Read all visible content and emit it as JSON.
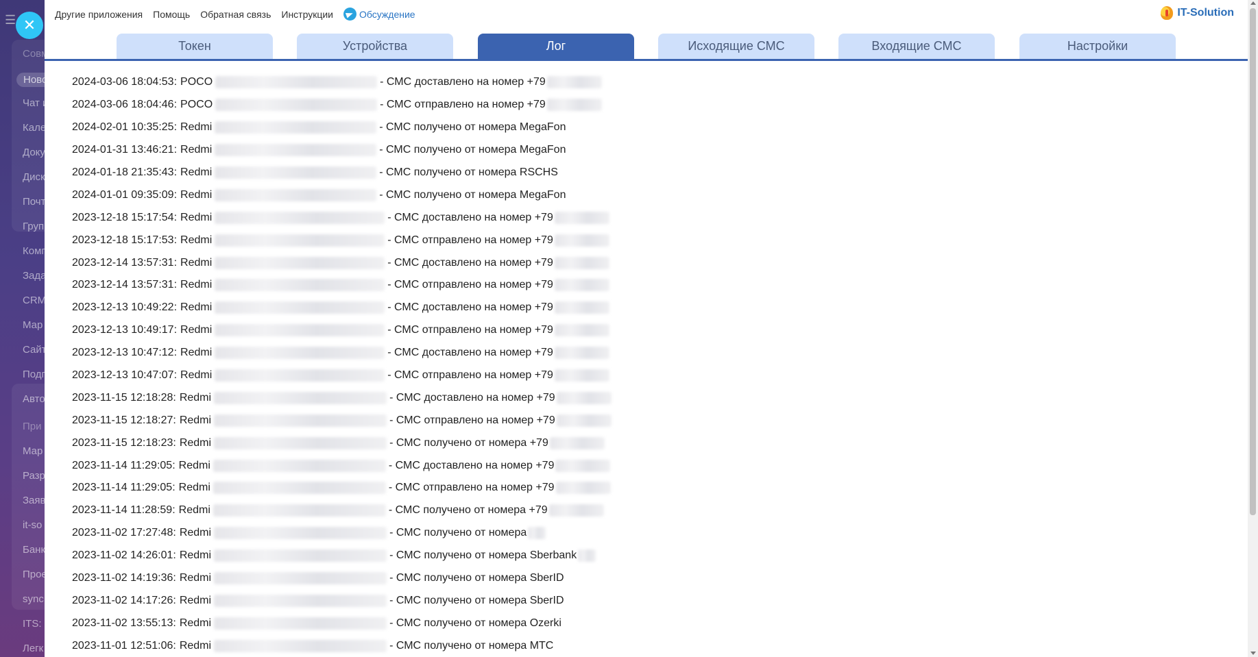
{
  "sidebar": {
    "items": [
      "Совм",
      "Ново",
      "Чат и",
      "Кале",
      "Доку",
      "Диск",
      "Почт",
      "Груп",
      "Комп",
      "Зада",
      "CRM",
      "Мар",
      "Сайт",
      "Подп",
      "Авто",
      "При",
      "Мар",
      "Разр",
      "Заяв",
      "it-so",
      "Банк",
      "Прое",
      "sync",
      "ITS: ",
      "Легк"
    ]
  },
  "topbar": {
    "links": [
      "Другие приложения",
      "Помощь",
      "Обратная связь",
      "Инструкции"
    ],
    "telegram_link": "Обсуждение",
    "brand": "IT-Solution"
  },
  "tabs": [
    {
      "label": "Токен",
      "active": false
    },
    {
      "label": "Устройства",
      "active": false
    },
    {
      "label": "Лог",
      "active": true
    },
    {
      "label": "Исходящие СМС",
      "active": false
    },
    {
      "label": "Входящие СМС",
      "active": false
    },
    {
      "label": "Настройки",
      "active": false
    }
  ],
  "log": [
    {
      "time": "2024-03-06 18:04:53:",
      "device": "POCO",
      "message": "- СМС доставлено на номер +79",
      "tail": "phone"
    },
    {
      "time": "2024-03-06 18:04:46:",
      "device": "POCO",
      "message": "- СМС отправлено на номер +79",
      "tail": "phone"
    },
    {
      "time": "2024-02-01 10:35:25:",
      "device": "Redmi",
      "message": "- СМС получено от номера MegaFon",
      "tail": ""
    },
    {
      "time": "2024-01-31 13:46:21:",
      "device": "Redmi",
      "message": "- СМС получено от номера MegaFon",
      "tail": ""
    },
    {
      "time": "2024-01-18 21:35:43:",
      "device": "Redmi",
      "message": "- СМС получено от номера RSCHS",
      "tail": ""
    },
    {
      "time": "2024-01-01 09:35:09:",
      "device": "Redmi",
      "message": "- СМС получено от номера MegaFon",
      "tail": ""
    },
    {
      "time": "2023-12-18 15:17:54:",
      "device": "Redmi",
      "message": "- СМС доставлено на номер +79",
      "tail": "phone"
    },
    {
      "time": "2023-12-18 15:17:53:",
      "device": "Redmi",
      "message": "- СМС отправлено на номер +79",
      "tail": "phone"
    },
    {
      "time": "2023-12-14 13:57:31:",
      "device": "Redmi",
      "message": "- СМС доставлено на номер +79",
      "tail": "phone"
    },
    {
      "time": "2023-12-14 13:57:31:",
      "device": "Redmi",
      "message": "- СМС отправлено на номер +79",
      "tail": "phone"
    },
    {
      "time": "2023-12-13 10:49:22:",
      "device": "Redmi",
      "message": "- СМС доставлено на номер +79",
      "tail": "phone"
    },
    {
      "time": "2023-12-13 10:49:17:",
      "device": "Redmi",
      "message": "- СМС отправлено на номер +79",
      "tail": "phone"
    },
    {
      "time": "2023-12-13 10:47:12:",
      "device": "Redmi",
      "message": "- СМС доставлено на номер +79",
      "tail": "phone"
    },
    {
      "time": "2023-12-13 10:47:07:",
      "device": "Redmi",
      "message": "- СМС отправлено на номер +79",
      "tail": "phone"
    },
    {
      "time": "2023-11-15 12:18:28:",
      "device": "Redmi",
      "message": "- СМС доставлено на номер +79",
      "tail": "phone"
    },
    {
      "time": "2023-11-15 12:18:27:",
      "device": "Redmi",
      "message": "- СМС отправлено на номер +79",
      "tail": "phone"
    },
    {
      "time": "2023-11-15 12:18:23:",
      "device": "Redmi",
      "message": "- СМС получено от номера +79",
      "tail": "phone"
    },
    {
      "time": "2023-11-14 11:29:05:",
      "device": "Redmi",
      "message": "- СМС доставлено на номер +79",
      "tail": "phone"
    },
    {
      "time": "2023-11-14 11:29:05:",
      "device": "Redmi",
      "message": "- СМС отправлено на номер +79",
      "tail": "phone"
    },
    {
      "time": "2023-11-14 11:28:59:",
      "device": "Redmi",
      "message": "- СМС получено от номера +79",
      "tail": "phone"
    },
    {
      "time": "2023-11-02 17:27:48:",
      "device": "Redmi",
      "message": "- СМС получено от номера",
      "tail": "tiny"
    },
    {
      "time": "2023-11-02 14:26:01:",
      "device": "Redmi",
      "message": "- СМС получено от номера Sberbank",
      "tail": "tiny"
    },
    {
      "time": "2023-11-02 14:19:36:",
      "device": "Redmi",
      "message": "- СМС получено от номера SberID",
      "tail": ""
    },
    {
      "time": "2023-11-02 14:17:26:",
      "device": "Redmi",
      "message": "- СМС получено от номера SberID",
      "tail": ""
    },
    {
      "time": "2023-11-02 13:55:13:",
      "device": "Redmi",
      "message": "- СМС получено от номера Ozerki",
      "tail": ""
    },
    {
      "time": "2023-11-01 12:51:06:",
      "device": "Redmi",
      "message": "- СМС получено от номера МТС",
      "tail": ""
    }
  ]
}
